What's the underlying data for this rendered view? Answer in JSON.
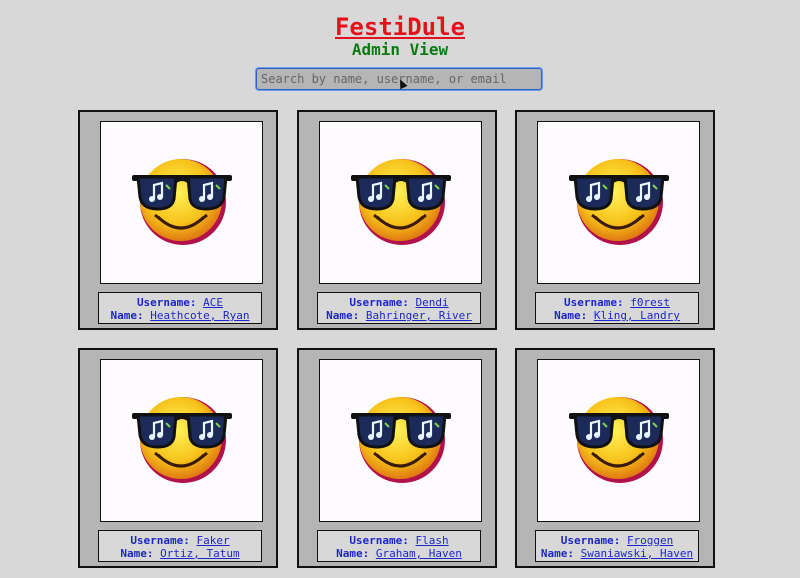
{
  "header": {
    "title": "FestiDule",
    "subtitle": "Admin View"
  },
  "search": {
    "placeholder": "Search by name, username, or email",
    "value": ""
  },
  "labels": {
    "username": "Username",
    "name": "Name"
  },
  "avatar_icon": "cool-smiley-sunglasses-icon",
  "users": [
    {
      "username": "ACE",
      "name": "Heathcote, Ryan"
    },
    {
      "username": "Dendi",
      "name": "Bahringer, River"
    },
    {
      "username": "f0rest",
      "name": "Kling, Landry"
    },
    {
      "username": "Faker",
      "name": "Ortiz, Tatum"
    },
    {
      "username": "Flash",
      "name": "Graham, Haven"
    },
    {
      "username": "Froggen",
      "name": "Swaniawski, Haven"
    }
  ],
  "colors": {
    "background": "#d9d8d9",
    "title": "#e0141a",
    "subtitle": "#0c7a13",
    "card": "#b6b5b6",
    "link": "#1d27c8"
  }
}
